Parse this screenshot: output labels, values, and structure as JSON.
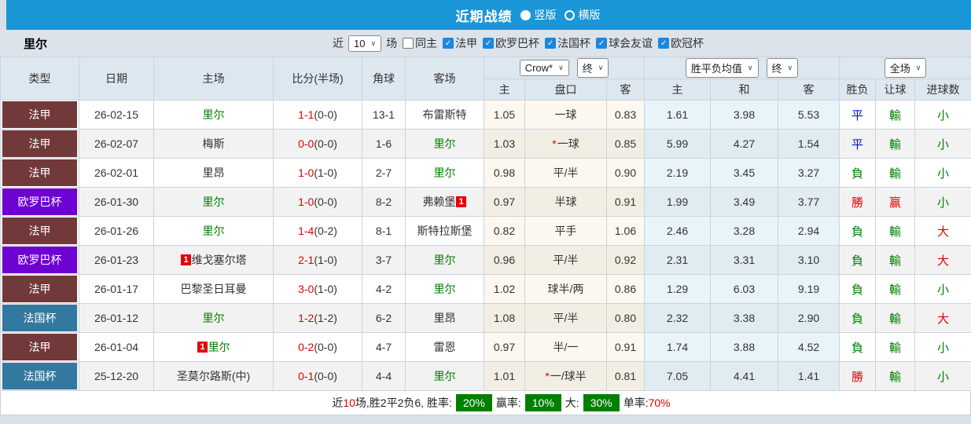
{
  "topbar": {
    "title": "近期战绩",
    "options": [
      {
        "label": "竖版",
        "selected": true
      },
      {
        "label": "横版",
        "selected": false
      }
    ]
  },
  "filter": {
    "team": "里尔",
    "near_label": "近",
    "count": "10",
    "count_suffix": "场",
    "checkboxes": [
      {
        "label": "同主",
        "checked": false
      },
      {
        "label": "法甲",
        "checked": true
      },
      {
        "label": "欧罗巴杯",
        "checked": true
      },
      {
        "label": "法国杯",
        "checked": true
      },
      {
        "label": "球会友谊",
        "checked": true
      },
      {
        "label": "欧冠杯",
        "checked": true
      }
    ]
  },
  "table": {
    "left_headers": [
      "类型",
      "日期",
      "主场",
      "比分(半场)",
      "角球",
      "客场"
    ],
    "dropdowns": {
      "company": "Crow*",
      "company_state": "终",
      "mean": "胜平负均值",
      "mean_state": "终",
      "scope": "全场"
    },
    "sub_headers": [
      "主",
      "盘口",
      "客",
      "主",
      "和",
      "客",
      "胜负",
      "让球",
      "进球数"
    ],
    "rows": [
      {
        "type": "法甲",
        "type_key": "ligue1",
        "date": "26-02-15",
        "home": "里尔",
        "home_c": "green",
        "home_badge": "",
        "score": "1-1",
        "half": "(0-0)",
        "corners": "13-1",
        "away": "布雷斯特",
        "away_c": "black",
        "away_badge": "",
        "odds_home": "1.05",
        "star": "",
        "handicap": "一球",
        "odds_away": "0.83",
        "mean_home": "1.61",
        "mean_draw": "3.98",
        "mean_away": "5.53",
        "result": "平",
        "result_c": "blue",
        "hresult": "輸",
        "hresult_c": "green",
        "goals": "小",
        "goals_c": "green"
      },
      {
        "type": "法甲",
        "type_key": "ligue1",
        "date": "26-02-07",
        "home": "梅斯",
        "home_c": "black",
        "home_badge": "",
        "score": "0-0",
        "half": "(0-0)",
        "corners": "1-6",
        "away": "里尔",
        "away_c": "green",
        "away_badge": "",
        "odds_home": "1.03",
        "star": "*",
        "handicap": "一球",
        "odds_away": "0.85",
        "mean_home": "5.99",
        "mean_draw": "4.27",
        "mean_away": "1.54",
        "result": "平",
        "result_c": "blue",
        "hresult": "輸",
        "hresult_c": "green",
        "goals": "小",
        "goals_c": "green"
      },
      {
        "type": "法甲",
        "type_key": "ligue1",
        "date": "26-02-01",
        "home": "里昂",
        "home_c": "black",
        "home_badge": "",
        "score": "1-0",
        "half": "(1-0)",
        "corners": "2-7",
        "away": "里尔",
        "away_c": "green",
        "away_badge": "",
        "odds_home": "0.98",
        "star": "",
        "handicap": "平/半",
        "odds_away": "0.90",
        "mean_home": "2.19",
        "mean_draw": "3.45",
        "mean_away": "3.27",
        "result": "負",
        "result_c": "green",
        "hresult": "輸",
        "hresult_c": "green",
        "goals": "小",
        "goals_c": "green"
      },
      {
        "type": "欧罗巴杯",
        "type_key": "europa",
        "date": "26-01-30",
        "home": "里尔",
        "home_c": "green",
        "home_badge": "",
        "score": "1-0",
        "half": "(0-0)",
        "corners": "8-2",
        "away": "弗赖堡",
        "away_c": "black",
        "away_badge": "1",
        "odds_home": "0.97",
        "star": "",
        "handicap": "半球",
        "odds_away": "0.91",
        "mean_home": "1.99",
        "mean_draw": "3.49",
        "mean_away": "3.77",
        "result": "勝",
        "result_c": "red",
        "hresult": "赢",
        "hresult_c": "red",
        "goals": "小",
        "goals_c": "green"
      },
      {
        "type": "法甲",
        "type_key": "ligue1",
        "date": "26-01-26",
        "home": "里尔",
        "home_c": "green",
        "home_badge": "",
        "score": "1-4",
        "half": "(0-2)",
        "corners": "8-1",
        "away": "斯特拉斯堡",
        "away_c": "black",
        "away_badge": "",
        "odds_home": "0.82",
        "star": "",
        "handicap": "平手",
        "odds_away": "1.06",
        "mean_home": "2.46",
        "mean_draw": "3.28",
        "mean_away": "2.94",
        "result": "負",
        "result_c": "green",
        "hresult": "輸",
        "hresult_c": "green",
        "goals": "大",
        "goals_c": "red"
      },
      {
        "type": "欧罗巴杯",
        "type_key": "europa",
        "date": "26-01-23",
        "home": "维戈塞尔塔",
        "home_c": "black",
        "home_badge": "1",
        "score": "2-1",
        "half": "(1-0)",
        "corners": "3-7",
        "away": "里尔",
        "away_c": "green",
        "away_badge": "",
        "odds_home": "0.96",
        "star": "",
        "handicap": "平/半",
        "odds_away": "0.92",
        "mean_home": "2.31",
        "mean_draw": "3.31",
        "mean_away": "3.10",
        "result": "負",
        "result_c": "green",
        "hresult": "輸",
        "hresult_c": "green",
        "goals": "大",
        "goals_c": "red"
      },
      {
        "type": "法甲",
        "type_key": "ligue1",
        "date": "26-01-17",
        "home": "巴黎圣日耳曼",
        "home_c": "black",
        "home_badge": "",
        "score": "3-0",
        "half": "(1-0)",
        "corners": "4-2",
        "away": "里尔",
        "away_c": "green",
        "away_badge": "",
        "odds_home": "1.02",
        "star": "",
        "handicap": "球半/两",
        "odds_away": "0.86",
        "mean_home": "1.29",
        "mean_draw": "6.03",
        "mean_away": "9.19",
        "result": "負",
        "result_c": "green",
        "hresult": "輸",
        "hresult_c": "green",
        "goals": "小",
        "goals_c": "green"
      },
      {
        "type": "法国杯",
        "type_key": "coupe",
        "date": "26-01-12",
        "home": "里尔",
        "home_c": "green",
        "home_badge": "",
        "score": "1-2",
        "half": "(1-2)",
        "corners": "6-2",
        "away": "里昂",
        "away_c": "black",
        "away_badge": "",
        "odds_home": "1.08",
        "star": "",
        "handicap": "平/半",
        "odds_away": "0.80",
        "mean_home": "2.32",
        "mean_draw": "3.38",
        "mean_away": "2.90",
        "result": "負",
        "result_c": "green",
        "hresult": "輸",
        "hresult_c": "green",
        "goals": "大",
        "goals_c": "red"
      },
      {
        "type": "法甲",
        "type_key": "ligue1",
        "date": "26-01-04",
        "home": "里尔",
        "home_c": "green",
        "home_badge": "1",
        "score": "0-2",
        "half": "(0-0)",
        "corners": "4-7",
        "away": "雷恩",
        "away_c": "black",
        "away_badge": "",
        "odds_home": "0.97",
        "star": "",
        "handicap": "半/一",
        "odds_away": "0.91",
        "mean_home": "1.74",
        "mean_draw": "3.88",
        "mean_away": "4.52",
        "result": "負",
        "result_c": "green",
        "hresult": "輸",
        "hresult_c": "green",
        "goals": "小",
        "goals_c": "green"
      },
      {
        "type": "法国杯",
        "type_key": "coupe",
        "date": "25-12-20",
        "home": "圣莫尔路斯(中)",
        "home_c": "black",
        "home_badge": "",
        "score": "0-1",
        "half": "(0-0)",
        "corners": "4-4",
        "away": "里尔",
        "away_c": "green",
        "away_badge": "",
        "odds_home": "1.01",
        "star": "*",
        "handicap": "一/球半",
        "odds_away": "0.81",
        "mean_home": "7.05",
        "mean_draw": "4.41",
        "mean_away": "1.41",
        "result": "勝",
        "result_c": "red",
        "hresult": "輸",
        "hresult_c": "green",
        "goals": "小",
        "goals_c": "green"
      }
    ]
  },
  "summary": {
    "near": "近",
    "count": "10",
    "stats": "场,胜2平2负6, 胜率:",
    "win_rate": "20%",
    "win_label": "赢率:",
    "odds_win_rate": "10%",
    "big_label": "大:",
    "big_rate": "30%",
    "single_label": "单率:",
    "single_rate": "70%"
  },
  "colors": {
    "topbar_blue": "#1b96d6",
    "ligue1": "#72393a",
    "europa": "#6e00d2",
    "coupe": "#33799f",
    "team_green": "#008000",
    "score_red": "#e00000",
    "draw_blue": "#0014cc",
    "badge_green": "#008000"
  }
}
